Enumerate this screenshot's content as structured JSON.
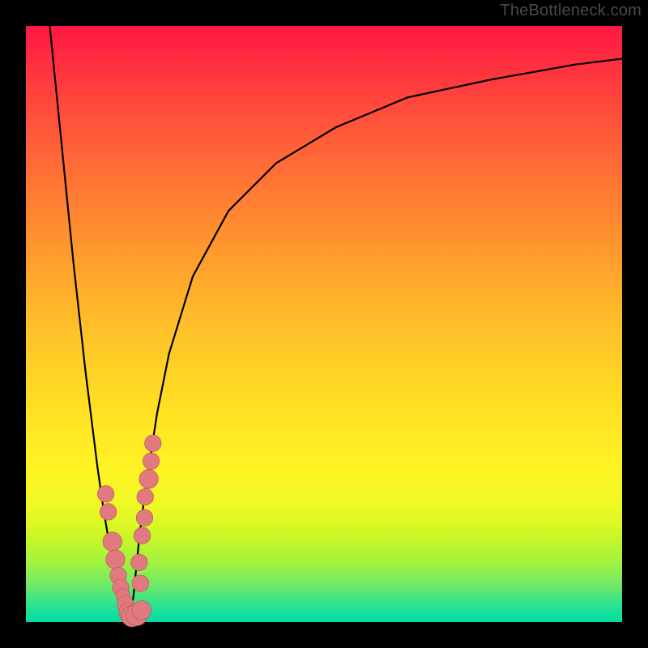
{
  "watermark": "TheBottleneck.com",
  "colors": {
    "frame": "#000000",
    "gradient_top": "#ff1744",
    "gradient_bottom": "#00dca6",
    "curve_stroke": "#000000",
    "marker_fill": "#e07a7e",
    "marker_stroke": "#b45358"
  },
  "chart_data": {
    "type": "line",
    "title": "",
    "xlabel": "",
    "ylabel": "",
    "xlim": [
      0,
      100
    ],
    "ylim": [
      0,
      100
    ],
    "legend": false,
    "grid": false,
    "series": [
      {
        "name": "bottleneck-left",
        "x": [
          4,
          6,
          8,
          10,
          12,
          13,
          14,
          15,
          16,
          16.8,
          17.4
        ],
        "values": [
          100,
          80,
          60,
          42,
          26,
          19,
          13,
          8.5,
          5,
          2.5,
          1
        ]
      },
      {
        "name": "bottleneck-right",
        "x": [
          17.4,
          18,
          18.5,
          19,
          20,
          22,
          24,
          28,
          34,
          42,
          52,
          64,
          78,
          92,
          100
        ],
        "values": [
          1,
          4,
          9,
          14,
          22,
          35,
          45,
          58,
          69,
          77,
          83,
          88,
          91,
          93.5,
          94.5
        ]
      }
    ],
    "markers": [
      {
        "x": 13.4,
        "y": 21.5,
        "r": 1.4
      },
      {
        "x": 13.8,
        "y": 18.5,
        "r": 1.4
      },
      {
        "x": 14.5,
        "y": 13.5,
        "r": 1.6
      },
      {
        "x": 15.0,
        "y": 10.5,
        "r": 1.6
      },
      {
        "x": 15.5,
        "y": 7.8,
        "r": 1.4
      },
      {
        "x": 15.9,
        "y": 5.8,
        "r": 1.4
      },
      {
        "x": 16.3,
        "y": 4.4,
        "r": 1.2
      },
      {
        "x": 16.7,
        "y": 3.0,
        "r": 1.4
      },
      {
        "x": 17.2,
        "y": 1.6,
        "r": 1.6
      },
      {
        "x": 17.8,
        "y": 1.0,
        "r": 1.8
      },
      {
        "x": 18.6,
        "y": 1.2,
        "r": 1.8
      },
      {
        "x": 19.4,
        "y": 2.0,
        "r": 1.6
      },
      {
        "x": 19.5,
        "y": 14.5,
        "r": 1.4
      },
      {
        "x": 19.9,
        "y": 17.5,
        "r": 1.4
      },
      {
        "x": 20.0,
        "y": 21.0,
        "r": 1.4
      },
      {
        "x": 20.6,
        "y": 24.0,
        "r": 1.6
      },
      {
        "x": 21.0,
        "y": 27.0,
        "r": 1.4
      },
      {
        "x": 21.3,
        "y": 30.0,
        "r": 1.4
      },
      {
        "x": 19.0,
        "y": 10.0,
        "r": 1.4
      },
      {
        "x": 19.2,
        "y": 6.5,
        "r": 1.4
      }
    ]
  }
}
